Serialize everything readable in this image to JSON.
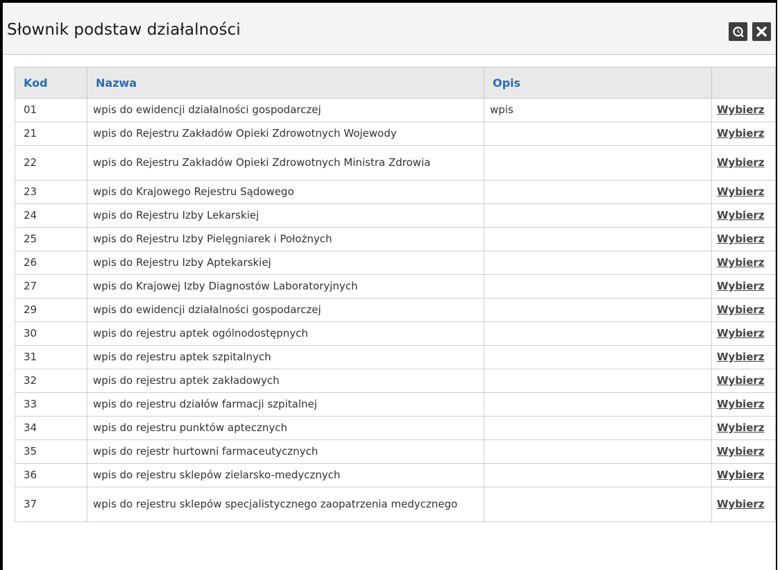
{
  "dialog": {
    "title": "Słownik podstaw działalności",
    "buttons": [
      {
        "name": "zoom",
        "icon": "magnifier-icon"
      },
      {
        "name": "close",
        "icon": "close-icon"
      }
    ]
  },
  "table": {
    "headers": {
      "kod": "Kod",
      "nazwa": "Nazwa",
      "opis": "Opis",
      "action": ""
    },
    "action_label": "Wybierz",
    "rows": [
      {
        "kod": "01",
        "nazwa": "wpis do ewidencji działalności gospodarczej",
        "opis": "wpis"
      },
      {
        "kod": "21",
        "nazwa": "wpis do Rejestru Zakładów Opieki Zdrowotnych Wojewody",
        "opis": ""
      },
      {
        "kod": "22",
        "nazwa": "wpis do Rejestru Zakładów Opieki Zdrowotnych Ministra Zdrowia",
        "opis": ""
      },
      {
        "kod": "23",
        "nazwa": "wpis do Krajowego Rejestru Sądowego",
        "opis": ""
      },
      {
        "kod": "24",
        "nazwa": "wpis do Rejestru Izby Lekarskiej",
        "opis": ""
      },
      {
        "kod": "25",
        "nazwa": "wpis do Rejestru Izby Pielęgniarek i Położnych",
        "opis": ""
      },
      {
        "kod": "26",
        "nazwa": "wpis do Rejestru Izby Aptekarskiej",
        "opis": ""
      },
      {
        "kod": "27",
        "nazwa": "wpis do Krajowej Izby Diagnostów Laboratoryjnych",
        "opis": ""
      },
      {
        "kod": "29",
        "nazwa": "wpis do ewidencji działalności gospodarczej",
        "opis": ""
      },
      {
        "kod": "30",
        "nazwa": "wpis do rejestru aptek ogólnodostępnych",
        "opis": ""
      },
      {
        "kod": "31",
        "nazwa": "wpis do rejestru aptek szpitalnych",
        "opis": ""
      },
      {
        "kod": "32",
        "nazwa": "wpis do rejestru aptek zakładowych",
        "opis": ""
      },
      {
        "kod": "33",
        "nazwa": "wpis do rejestru działów farmacji szpitalnej",
        "opis": ""
      },
      {
        "kod": "34",
        "nazwa": "wpis do rejestru punktów aptecznych",
        "opis": ""
      },
      {
        "kod": "35",
        "nazwa": "wpis do rejestr hurtowni farmaceutycznych",
        "opis": ""
      },
      {
        "kod": "36",
        "nazwa": "wpis do rejestru sklepów zielarsko-medycznych",
        "opis": ""
      },
      {
        "kod": "37",
        "nazwa": "wpis do rejestru sklepów specjalistycznego zaopatrzenia medycznego",
        "opis": ""
      }
    ]
  },
  "colors": {
    "header_text": "#2b6cb3",
    "header_bg": "#e9e9e9",
    "titlebar_bg": "#f4f4f4",
    "button_bg": "#3e3e3e"
  }
}
